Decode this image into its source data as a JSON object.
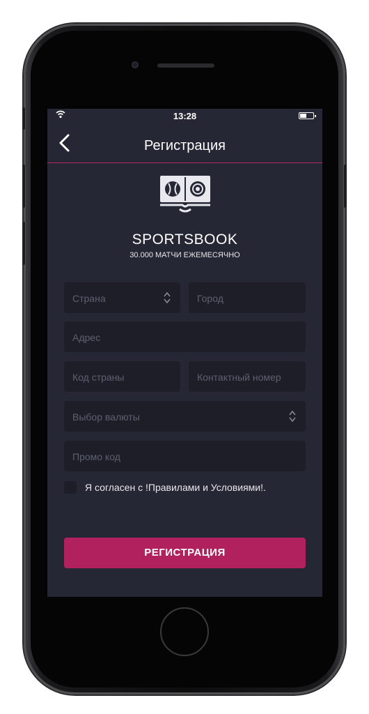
{
  "status": {
    "time": "13:28"
  },
  "nav": {
    "title": "Регистрация"
  },
  "brand": {
    "name": "SPORTSBOOK",
    "tagline": "30.000 МАТЧИ ЕЖЕМЕСЯЧНО"
  },
  "form": {
    "country_placeholder": "Страна",
    "city_placeholder": "Город",
    "address_placeholder": "Адрес",
    "country_code_placeholder": "Код страны",
    "phone_placeholder": "Контактный номер",
    "currency_placeholder": "Выбор валюты",
    "promo_placeholder": "Промо код",
    "terms_label": "Я согласен с !Правилами и Условиями!.",
    "submit_label": "РЕГИСТРАЦИЯ"
  },
  "colors": {
    "accent": "#b0215e",
    "background": "#252734",
    "field": "#1d1e28"
  },
  "icons": {
    "back": "chevron-left-icon",
    "logo": "book-with-balls-icon",
    "select": "up-down-arrows-icon"
  }
}
